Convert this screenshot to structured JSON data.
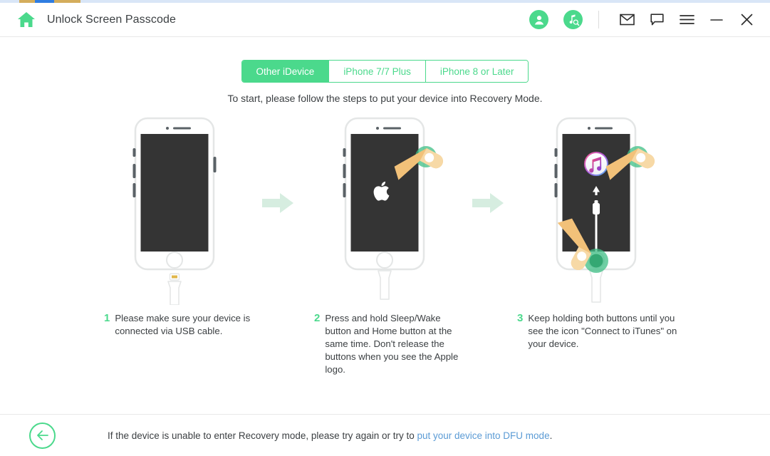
{
  "window": {
    "title": "Unlock Screen Passcode",
    "home_icon": "home-icon",
    "accent_green": "#4bd98c",
    "link_blue": "#5b9bd5",
    "controls": {
      "account": "account-icon",
      "music_search": "music-search-icon",
      "mail": "mail-icon",
      "feedback": "feedback-icon",
      "menu": "hamburger-menu-icon",
      "minimize": "minimize-icon",
      "close": "close-icon"
    }
  },
  "tabs": [
    {
      "label": "Other iDevice",
      "active": true
    },
    {
      "label": "iPhone 7/7 Plus",
      "active": false
    },
    {
      "label": "iPhone 8 or Later",
      "active": false
    }
  ],
  "subtitle": "To start, please follow the steps to put your device into Recovery Mode.",
  "illustrations": [
    {
      "screen": "blank",
      "cable": "detached",
      "touch_points": []
    },
    {
      "screen": "apple-logo",
      "cable": "attached",
      "touch_points": [
        "side-button"
      ]
    },
    {
      "screen": "connect-to-itunes",
      "cable": "attached",
      "touch_points": [
        "side-button",
        "home-button"
      ]
    }
  ],
  "steps": [
    {
      "num": "1",
      "text": "Please make sure your device is connected via USB cable."
    },
    {
      "num": "2",
      "text": "Press and hold Sleep/Wake button and Home button at the same time. Don't release the buttons when you see the Apple logo."
    },
    {
      "num": "3",
      "text": "Keep holding both buttons until you see the icon \"Connect to iTunes\" on your device."
    }
  ],
  "footer": {
    "back_label": "back-arrow",
    "text_before": "If the device is unable to enter Recovery mode, please try again or try to ",
    "link": "put your device into DFU mode",
    "text_after": "."
  }
}
